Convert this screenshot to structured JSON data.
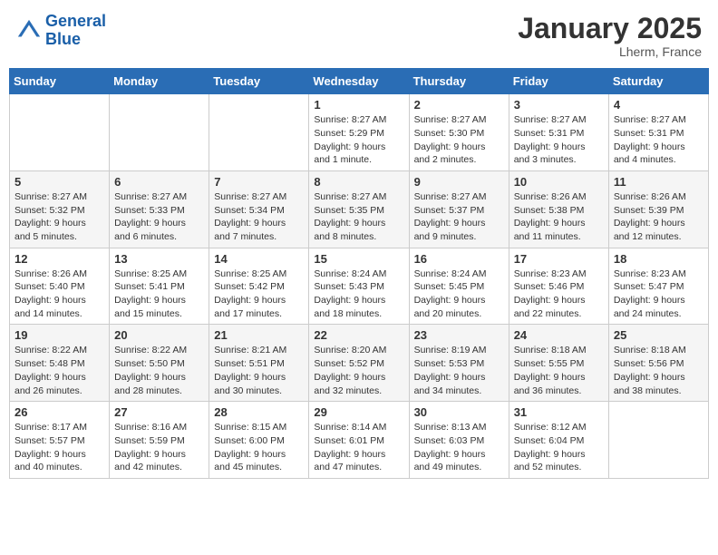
{
  "header": {
    "logo_line1": "General",
    "logo_line2": "Blue",
    "month_year": "January 2025",
    "location": "Lherm, France"
  },
  "weekdays": [
    "Sunday",
    "Monday",
    "Tuesday",
    "Wednesday",
    "Thursday",
    "Friday",
    "Saturday"
  ],
  "weeks": [
    [
      {
        "day": "",
        "sunrise": "",
        "sunset": "",
        "daylight": ""
      },
      {
        "day": "",
        "sunrise": "",
        "sunset": "",
        "daylight": ""
      },
      {
        "day": "",
        "sunrise": "",
        "sunset": "",
        "daylight": ""
      },
      {
        "day": "1",
        "sunrise": "Sunrise: 8:27 AM",
        "sunset": "Sunset: 5:29 PM",
        "daylight": "Daylight: 9 hours and 1 minute."
      },
      {
        "day": "2",
        "sunrise": "Sunrise: 8:27 AM",
        "sunset": "Sunset: 5:30 PM",
        "daylight": "Daylight: 9 hours and 2 minutes."
      },
      {
        "day": "3",
        "sunrise": "Sunrise: 8:27 AM",
        "sunset": "Sunset: 5:31 PM",
        "daylight": "Daylight: 9 hours and 3 minutes."
      },
      {
        "day": "4",
        "sunrise": "Sunrise: 8:27 AM",
        "sunset": "Sunset: 5:31 PM",
        "daylight": "Daylight: 9 hours and 4 minutes."
      }
    ],
    [
      {
        "day": "5",
        "sunrise": "Sunrise: 8:27 AM",
        "sunset": "Sunset: 5:32 PM",
        "daylight": "Daylight: 9 hours and 5 minutes."
      },
      {
        "day": "6",
        "sunrise": "Sunrise: 8:27 AM",
        "sunset": "Sunset: 5:33 PM",
        "daylight": "Daylight: 9 hours and 6 minutes."
      },
      {
        "day": "7",
        "sunrise": "Sunrise: 8:27 AM",
        "sunset": "Sunset: 5:34 PM",
        "daylight": "Daylight: 9 hours and 7 minutes."
      },
      {
        "day": "8",
        "sunrise": "Sunrise: 8:27 AM",
        "sunset": "Sunset: 5:35 PM",
        "daylight": "Daylight: 9 hours and 8 minutes."
      },
      {
        "day": "9",
        "sunrise": "Sunrise: 8:27 AM",
        "sunset": "Sunset: 5:37 PM",
        "daylight": "Daylight: 9 hours and 9 minutes."
      },
      {
        "day": "10",
        "sunrise": "Sunrise: 8:26 AM",
        "sunset": "Sunset: 5:38 PM",
        "daylight": "Daylight: 9 hours and 11 minutes."
      },
      {
        "day": "11",
        "sunrise": "Sunrise: 8:26 AM",
        "sunset": "Sunset: 5:39 PM",
        "daylight": "Daylight: 9 hours and 12 minutes."
      }
    ],
    [
      {
        "day": "12",
        "sunrise": "Sunrise: 8:26 AM",
        "sunset": "Sunset: 5:40 PM",
        "daylight": "Daylight: 9 hours and 14 minutes."
      },
      {
        "day": "13",
        "sunrise": "Sunrise: 8:25 AM",
        "sunset": "Sunset: 5:41 PM",
        "daylight": "Daylight: 9 hours and 15 minutes."
      },
      {
        "day": "14",
        "sunrise": "Sunrise: 8:25 AM",
        "sunset": "Sunset: 5:42 PM",
        "daylight": "Daylight: 9 hours and 17 minutes."
      },
      {
        "day": "15",
        "sunrise": "Sunrise: 8:24 AM",
        "sunset": "Sunset: 5:43 PM",
        "daylight": "Daylight: 9 hours and 18 minutes."
      },
      {
        "day": "16",
        "sunrise": "Sunrise: 8:24 AM",
        "sunset": "Sunset: 5:45 PM",
        "daylight": "Daylight: 9 hours and 20 minutes."
      },
      {
        "day": "17",
        "sunrise": "Sunrise: 8:23 AM",
        "sunset": "Sunset: 5:46 PM",
        "daylight": "Daylight: 9 hours and 22 minutes."
      },
      {
        "day": "18",
        "sunrise": "Sunrise: 8:23 AM",
        "sunset": "Sunset: 5:47 PM",
        "daylight": "Daylight: 9 hours and 24 minutes."
      }
    ],
    [
      {
        "day": "19",
        "sunrise": "Sunrise: 8:22 AM",
        "sunset": "Sunset: 5:48 PM",
        "daylight": "Daylight: 9 hours and 26 minutes."
      },
      {
        "day": "20",
        "sunrise": "Sunrise: 8:22 AM",
        "sunset": "Sunset: 5:50 PM",
        "daylight": "Daylight: 9 hours and 28 minutes."
      },
      {
        "day": "21",
        "sunrise": "Sunrise: 8:21 AM",
        "sunset": "Sunset: 5:51 PM",
        "daylight": "Daylight: 9 hours and 30 minutes."
      },
      {
        "day": "22",
        "sunrise": "Sunrise: 8:20 AM",
        "sunset": "Sunset: 5:52 PM",
        "daylight": "Daylight: 9 hours and 32 minutes."
      },
      {
        "day": "23",
        "sunrise": "Sunrise: 8:19 AM",
        "sunset": "Sunset: 5:53 PM",
        "daylight": "Daylight: 9 hours and 34 minutes."
      },
      {
        "day": "24",
        "sunrise": "Sunrise: 8:18 AM",
        "sunset": "Sunset: 5:55 PM",
        "daylight": "Daylight: 9 hours and 36 minutes."
      },
      {
        "day": "25",
        "sunrise": "Sunrise: 8:18 AM",
        "sunset": "Sunset: 5:56 PM",
        "daylight": "Daylight: 9 hours and 38 minutes."
      }
    ],
    [
      {
        "day": "26",
        "sunrise": "Sunrise: 8:17 AM",
        "sunset": "Sunset: 5:57 PM",
        "daylight": "Daylight: 9 hours and 40 minutes."
      },
      {
        "day": "27",
        "sunrise": "Sunrise: 8:16 AM",
        "sunset": "Sunset: 5:59 PM",
        "daylight": "Daylight: 9 hours and 42 minutes."
      },
      {
        "day": "28",
        "sunrise": "Sunrise: 8:15 AM",
        "sunset": "Sunset: 6:00 PM",
        "daylight": "Daylight: 9 hours and 45 minutes."
      },
      {
        "day": "29",
        "sunrise": "Sunrise: 8:14 AM",
        "sunset": "Sunset: 6:01 PM",
        "daylight": "Daylight: 9 hours and 47 minutes."
      },
      {
        "day": "30",
        "sunrise": "Sunrise: 8:13 AM",
        "sunset": "Sunset: 6:03 PM",
        "daylight": "Daylight: 9 hours and 49 minutes."
      },
      {
        "day": "31",
        "sunrise": "Sunrise: 8:12 AM",
        "sunset": "Sunset: 6:04 PM",
        "daylight": "Daylight: 9 hours and 52 minutes."
      },
      {
        "day": "",
        "sunrise": "",
        "sunset": "",
        "daylight": ""
      }
    ]
  ]
}
